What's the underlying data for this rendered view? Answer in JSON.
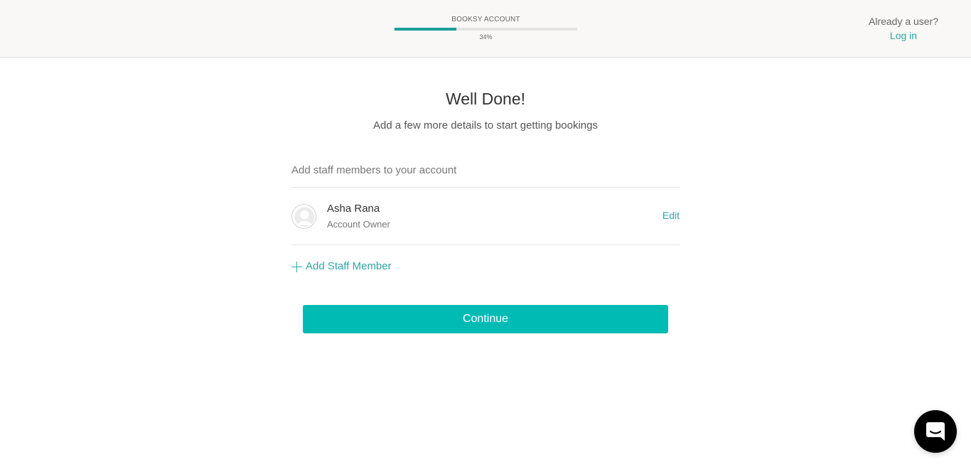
{
  "header": {
    "progress_title": "BOOKSY ACCOUNT",
    "progress_value": 0.34,
    "progress_label": "34%",
    "already_user_text": "Already a user?",
    "login_label": "Log in"
  },
  "main": {
    "title": "Well Done!",
    "subtitle": "Add a few more details to start getting bookings",
    "staff_section_label": "Add staff members to your account",
    "staff": [
      {
        "name": "Asha Rana",
        "role": "Account Owner",
        "edit_label": "Edit",
        "avatar_icon": "user-placeholder-icon"
      }
    ],
    "add_staff_label": "Add Staff Member",
    "continue_label": "Continue"
  },
  "chat": {
    "icon": "chat-bubble-icon"
  },
  "colors": {
    "accent": "#00bbb4",
    "link": "#2ba7a4",
    "progress_fill": "#1a9e9c",
    "header_bg": "#f9f8f6"
  }
}
